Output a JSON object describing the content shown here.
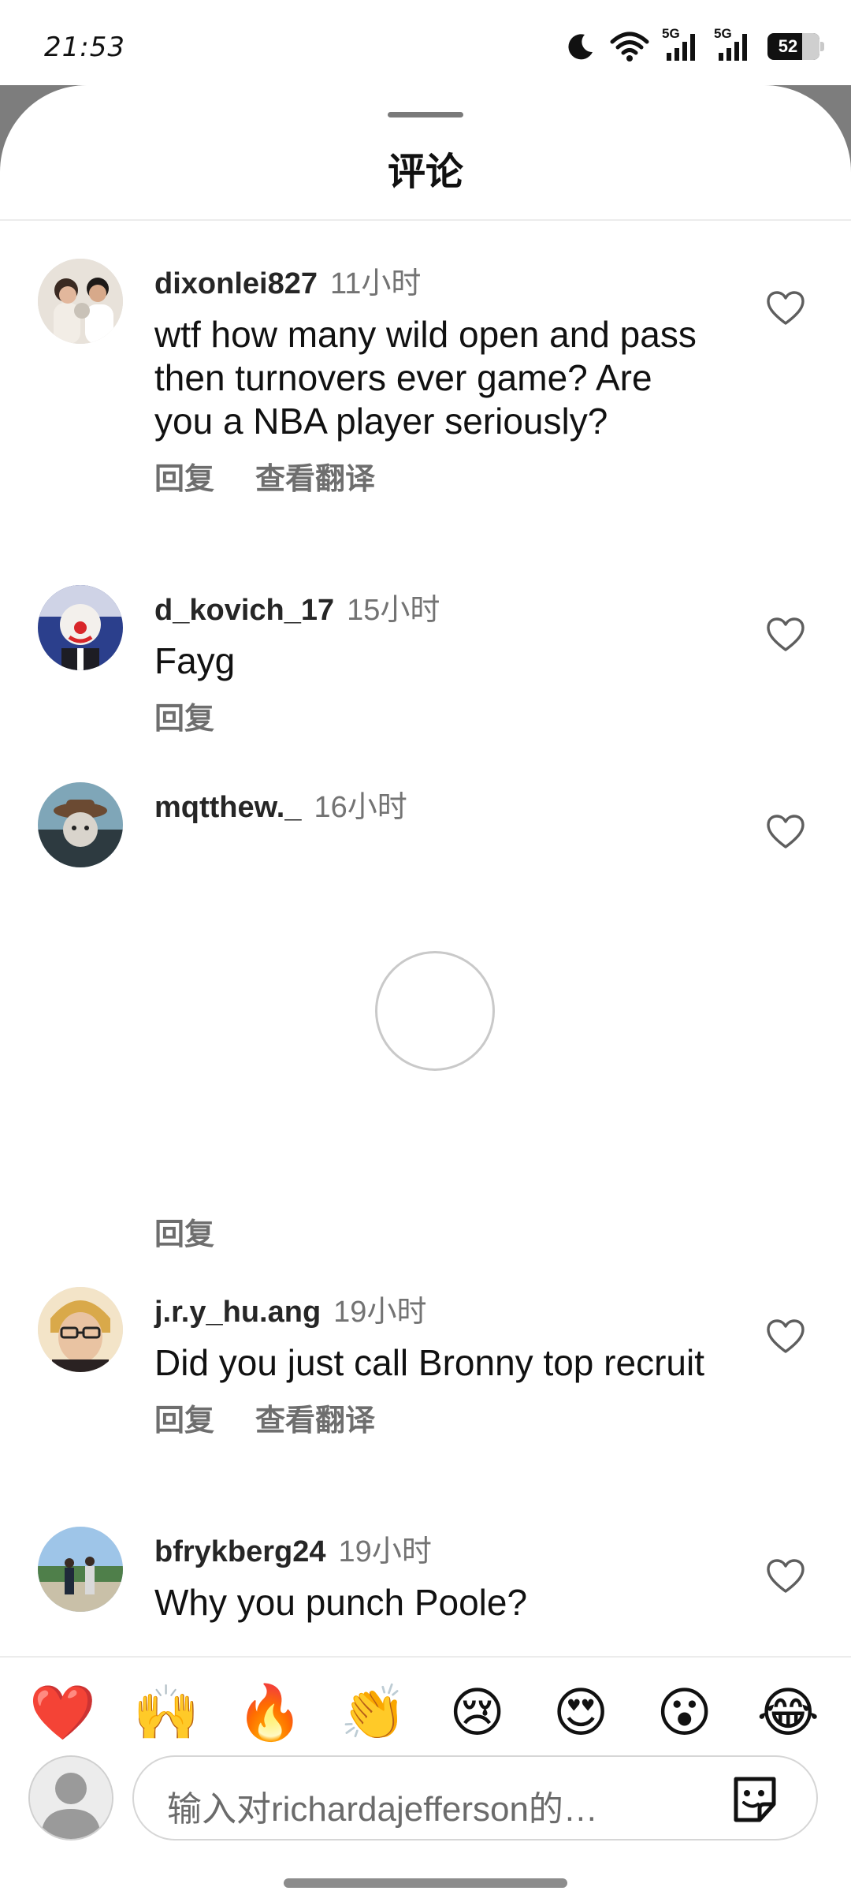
{
  "status_bar": {
    "time": "21:53",
    "network_1": "5G",
    "network_2": "5G",
    "battery": "52",
    "icons": [
      "moon-icon",
      "wifi-icon",
      "signal-icon",
      "signal-icon",
      "battery-icon"
    ]
  },
  "sheet": {
    "title": "评论"
  },
  "comments": [
    {
      "user": "dixonlei827",
      "time": "11小时",
      "text": "wtf how many wild open and pass then turnovers ever game?  Are you a NBA player seriously?",
      "reply": "回复",
      "translate": "查看翻译"
    },
    {
      "user": "d_kovich_17",
      "time": "15小时",
      "text": "Fayg",
      "reply": "回复"
    },
    {
      "user": "mqtthew._",
      "time": "16小时",
      "text": "",
      "reply": "回复"
    },
    {
      "user": "j.r.y_hu.ang",
      "time": "19小时",
      "text": "Did you just call Bronny top recruit",
      "reply": "回复",
      "translate": "查看翻译"
    },
    {
      "user": "bfrykberg24",
      "time": "19小时",
      "text": "Why you punch Poole?"
    }
  ],
  "composer": {
    "emojis": [
      "❤️",
      "🙌",
      "🔥",
      "👏",
      "😢",
      "😍",
      "😮",
      "😂"
    ],
    "placeholder": "输入对richardajefferson的…"
  },
  "colors": {
    "heart_red": "#e0243a",
    "text_primary": "#111111",
    "text_secondary": "#737373"
  }
}
